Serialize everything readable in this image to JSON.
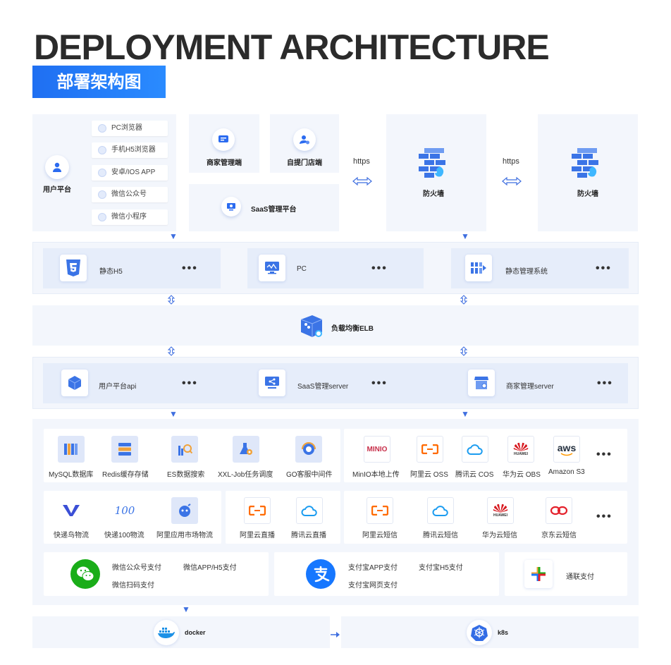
{
  "header": {
    "title": "DEPLOYMENT ARCHITECTURE",
    "subtitle": "部署架构图"
  },
  "clients": {
    "user_platform": "用户平台",
    "items": [
      "PC浏览器",
      "手机H5浏览器",
      "安卓/IOS APP",
      "微信公众号",
      "微信小程序"
    ],
    "merchant": "商家管理端",
    "pickup": "自提门店端",
    "saas": "SaaS管理平台"
  },
  "network": {
    "https1": "https",
    "https2": "https",
    "firewall1": "防火墙",
    "firewall2": "防火墙"
  },
  "static_row": {
    "h5": "静态H5",
    "pc": "PC",
    "admin": "静态管理系统"
  },
  "elb": "负载均衡ELB",
  "server_row": {
    "api": "用户平台api",
    "saas": "SaaS管理server",
    "merchant": "商家管理server"
  },
  "middleware": [
    "MySQL数据库",
    "Redis缓存存储",
    "ES数据搜索",
    "XXL-Job任务调度",
    "GO客服中间件"
  ],
  "storage": [
    "MinIO本地上传",
    "阿里云 OSS",
    "腾讯云 COS",
    "华为云 OBS",
    "Amazon S3"
  ],
  "logistics": [
    "快递鸟物流",
    "快递100物流",
    "阿里应用市场物流"
  ],
  "live": [
    "阿里云直播",
    "腾讯云直播"
  ],
  "sms": [
    "阿里云短信",
    "腾讯云短信",
    "华为云短信",
    "京东云短信"
  ],
  "pay_wechat": [
    "微信公众号支付",
    "微信APP/H5支付",
    "微信扫码支付"
  ],
  "pay_alipay": [
    "支付宝APP支付",
    "支付宝H5支付",
    "支付宝网页支付"
  ],
  "pay_union": "通联支付",
  "icon_text": {
    "minio": "MINIO",
    "aws": "aws",
    "huawei": "HUAWEI",
    "k100": "100"
  },
  "deploy": {
    "docker": "docker",
    "k8s": "k8s"
  },
  "colors": {
    "accent": "#1f6ff2",
    "panel": "#f3f6fc",
    "card": "#e6edfa",
    "arrow": "#3f6fe0"
  }
}
